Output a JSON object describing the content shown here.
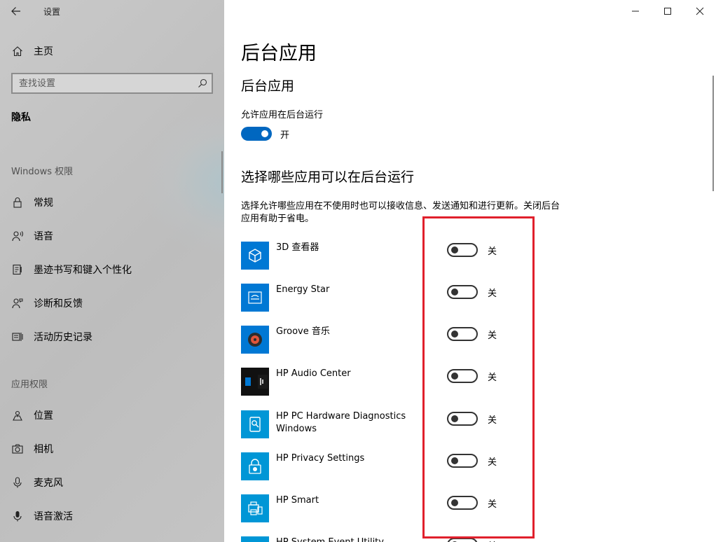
{
  "window": {
    "title": "设置",
    "controls": [
      "minimize",
      "maximize",
      "close"
    ]
  },
  "sidebar": {
    "home_label": "主页",
    "search_placeholder": "查找设置",
    "section": "隐私",
    "groups": [
      {
        "heading": "Windows 权限",
        "items": [
          {
            "label": "常规",
            "icon": "lock-icon"
          },
          {
            "label": "语音",
            "icon": "voice-icon"
          },
          {
            "label": "墨迹书写和键入个性化",
            "icon": "ink-icon"
          },
          {
            "label": "诊断和反馈",
            "icon": "feedback-icon"
          },
          {
            "label": "活动历史记录",
            "icon": "history-icon"
          }
        ]
      },
      {
        "heading": "应用权限",
        "items": [
          {
            "label": "位置",
            "icon": "location-icon"
          },
          {
            "label": "相机",
            "icon": "camera-icon"
          },
          {
            "label": "麦克风",
            "icon": "microphone-icon"
          },
          {
            "label": "语音激活",
            "icon": "voice-activation-icon"
          }
        ]
      }
    ]
  },
  "main": {
    "title": "后台应用",
    "subtitle": "后台应用",
    "allow_label": "允许应用在后台运行",
    "allow_state": "开",
    "choose_title": "选择哪些应用可以在后台运行",
    "description": "选择允许哪些应用在不使用时也可以接收信息、发送通知和进行更新。关闭后台应用有助于省电。",
    "apps": [
      {
        "name": "3D 查看器",
        "state": "关",
        "icon": "3d-viewer-icon"
      },
      {
        "name": "Energy Star",
        "state": "关",
        "icon": "energy-star-icon"
      },
      {
        "name": "Groove 音乐",
        "state": "关",
        "icon": "groove-music-icon"
      },
      {
        "name": "HP Audio Center",
        "state": "关",
        "icon": "hp-audio-center-icon"
      },
      {
        "name": "HP PC Hardware Diagnostics Windows",
        "state": "关",
        "icon": "hp-diagnostics-icon"
      },
      {
        "name": "HP Privacy Settings",
        "state": "关",
        "icon": "hp-privacy-icon"
      },
      {
        "name": "HP Smart",
        "state": "关",
        "icon": "hp-smart-icon"
      },
      {
        "name": "HP System Event Utility",
        "state": "关",
        "icon": "hp-event-utility-icon"
      }
    ]
  },
  "colors": {
    "accent": "#0067c0",
    "app_tile": "#0078d4",
    "highlight": "#e0202c"
  }
}
